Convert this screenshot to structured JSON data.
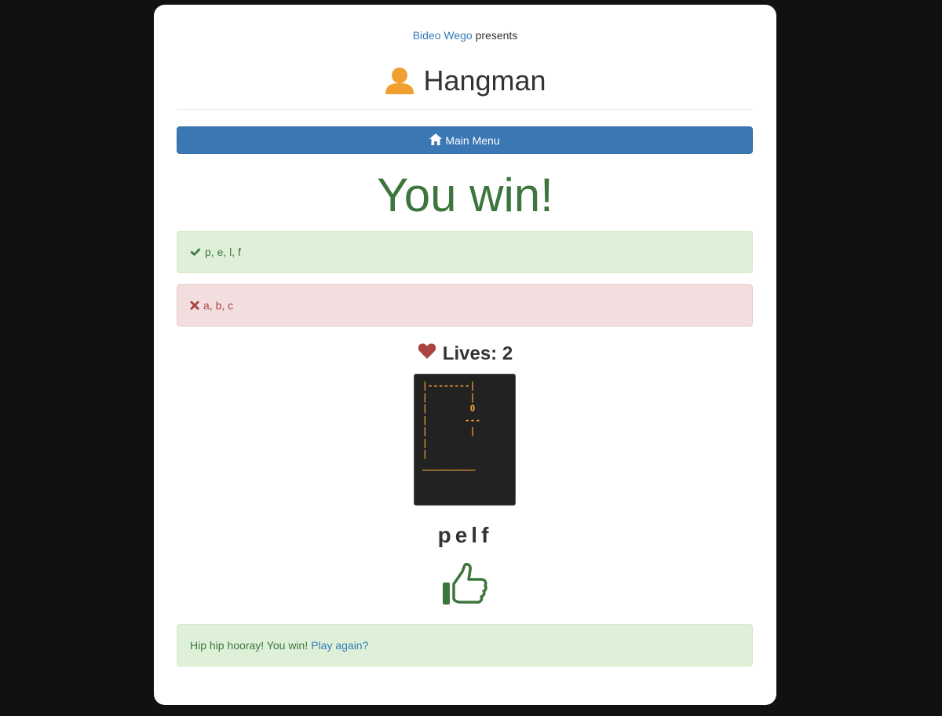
{
  "header": {
    "brand_link": "Bideo Wego",
    "presents": "presents",
    "title": "Hangman",
    "title_icon": "user-icon"
  },
  "menu_button": {
    "label": "Main Menu",
    "icon": "home-icon"
  },
  "result": {
    "heading": "You win!"
  },
  "correct_guesses": {
    "icon": "check-icon",
    "text": "p, e, l, f"
  },
  "wrong_guesses": {
    "icon": "x-icon",
    "text": "a, b, c"
  },
  "lives": {
    "icon": "heart-icon",
    "label": "Lives: 2"
  },
  "gallows_ascii": "|--------|\n|        |\n|        0\n|       ---\n|        |\n|\n|\n__________",
  "word": "pelf",
  "celebration_icon": "thumbs-up-icon",
  "footer": {
    "message": "Hip hip hooray! You win!",
    "play_again_link": "Play again?"
  },
  "colors": {
    "background": "#111111",
    "primary": "#3b77b4",
    "success_text": "#3c763d",
    "success_bg": "#dff0d8",
    "danger_text": "#a94442",
    "danger_bg": "#f2dede",
    "ascii": "#f0a030",
    "title_icon": "#f0a030"
  }
}
